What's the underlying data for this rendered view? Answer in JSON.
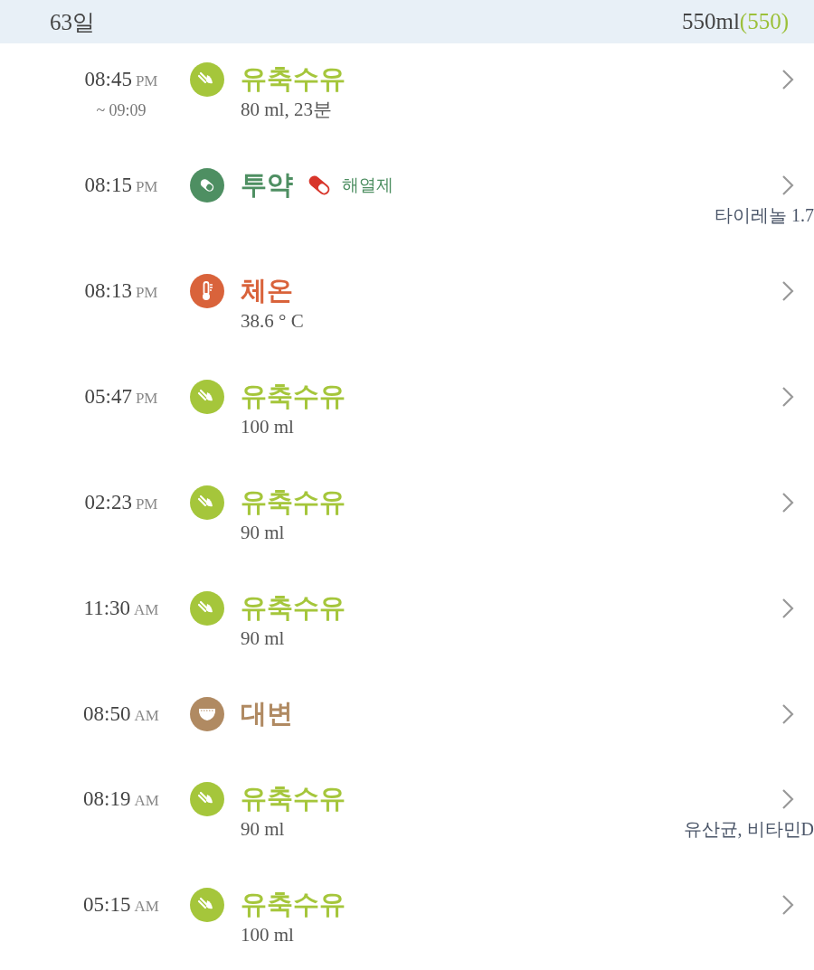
{
  "header": {
    "day": "63일",
    "total": "550ml",
    "count": "(550)"
  },
  "entries": [
    {
      "kind": "feeding",
      "time": "08:45",
      "ampm": "PM",
      "until": "~ 09:09",
      "title": "유축수유",
      "color": "#a5c63b",
      "detail": "80 ml, 23분"
    },
    {
      "kind": "medicine",
      "time": "08:15",
      "ampm": "PM",
      "title": "투약",
      "color": "#4e8f62",
      "tag": "해열제",
      "note": "타이레놀 1.7"
    },
    {
      "kind": "temperature",
      "time": "08:13",
      "ampm": "PM",
      "title": "체온",
      "color": "#d9633b",
      "detail": "38.6 ° C"
    },
    {
      "kind": "feeding",
      "time": "05:47",
      "ampm": "PM",
      "title": "유축수유",
      "color": "#a5c63b",
      "detail": "100 ml"
    },
    {
      "kind": "feeding",
      "time": "02:23",
      "ampm": "PM",
      "title": "유축수유",
      "color": "#a5c63b",
      "detail": "90 ml"
    },
    {
      "kind": "feeding",
      "time": "11:30",
      "ampm": "AM",
      "title": "유축수유",
      "color": "#a5c63b",
      "detail": "90 ml"
    },
    {
      "kind": "diaper",
      "time": "08:50",
      "ampm": "AM",
      "title": "대변",
      "color": "#b08a62"
    },
    {
      "kind": "feeding",
      "time": "08:19",
      "ampm": "AM",
      "title": "유축수유",
      "color": "#a5c63b",
      "detail": "90 ml",
      "note": "유산균, 비타민D"
    },
    {
      "kind": "feeding",
      "time": "05:15",
      "ampm": "AM",
      "title": "유축수유",
      "color": "#a5c63b",
      "detail": "100 ml"
    }
  ]
}
